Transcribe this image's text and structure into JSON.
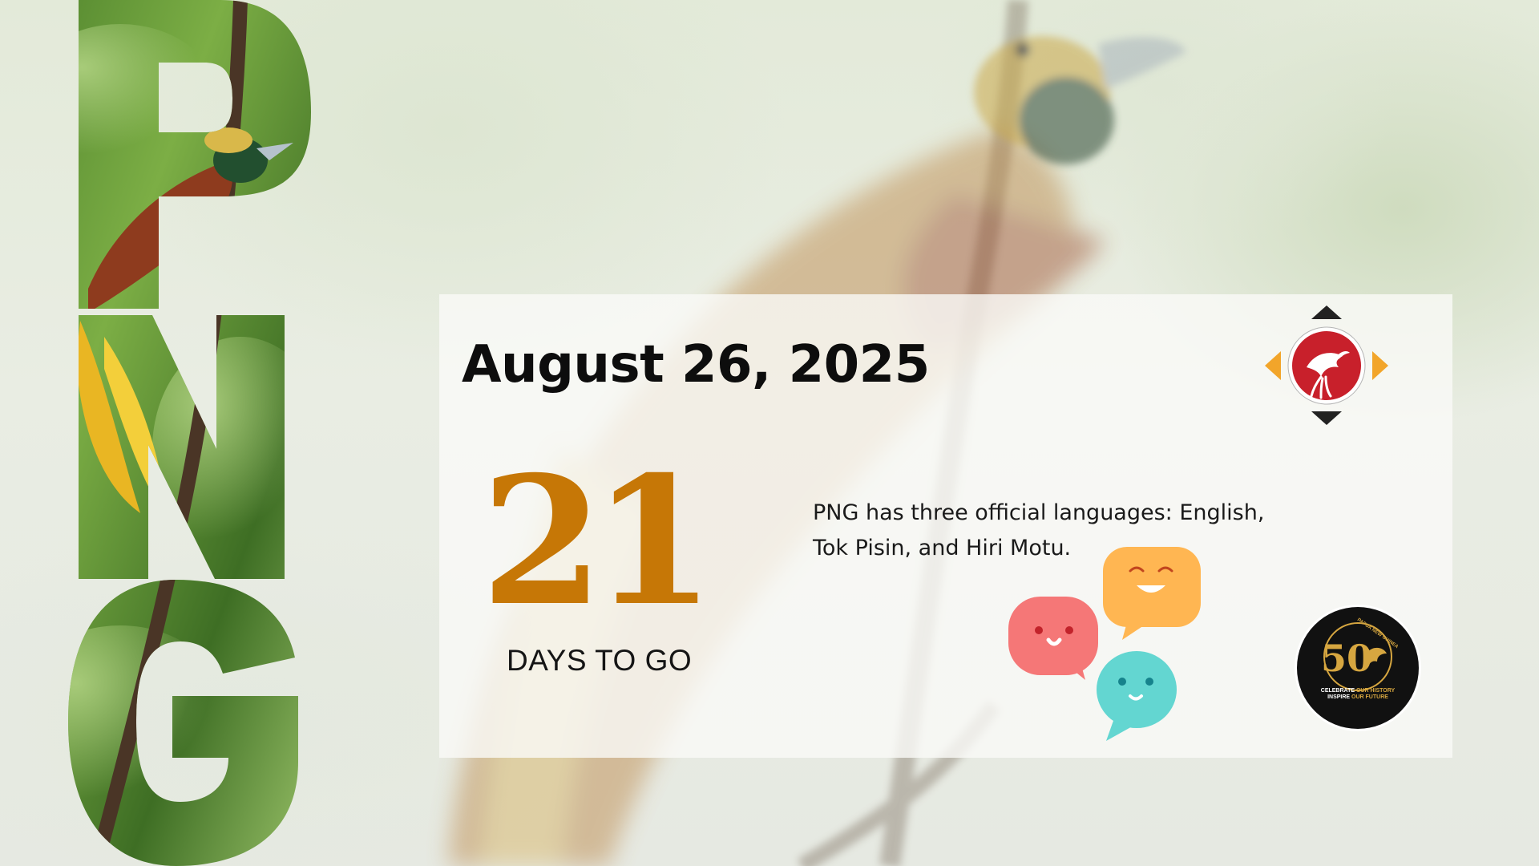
{
  "letters": [
    "P",
    "N",
    "G"
  ],
  "date": "August 26, 2025",
  "countdown": {
    "number": "21",
    "label": "DAYS TO GO"
  },
  "fact": {
    "line1": "PNG has three official languages: English,",
    "line2": "Tok Pisin, and Hiri Motu."
  },
  "badge": {
    "number": "50",
    "ring_text": "PAPUA NEW GUINEA",
    "tagline_1_a": "CELEBRATE",
    "tagline_1_b": "OUR HISTORY",
    "tagline_2_a": "INSPIRE",
    "tagline_2_b": "OUR FUTURE"
  },
  "icons": {
    "nav": "navigation-arrows-icon",
    "bird_emblem": "bird-of-paradise-emblem-icon",
    "bubbles": "chat-bubbles-icon"
  },
  "colors": {
    "accent": "#c67706",
    "emblem_red": "#c8202b",
    "arrow_orange": "#f2a52a",
    "badge_gold": "#d6a640"
  }
}
